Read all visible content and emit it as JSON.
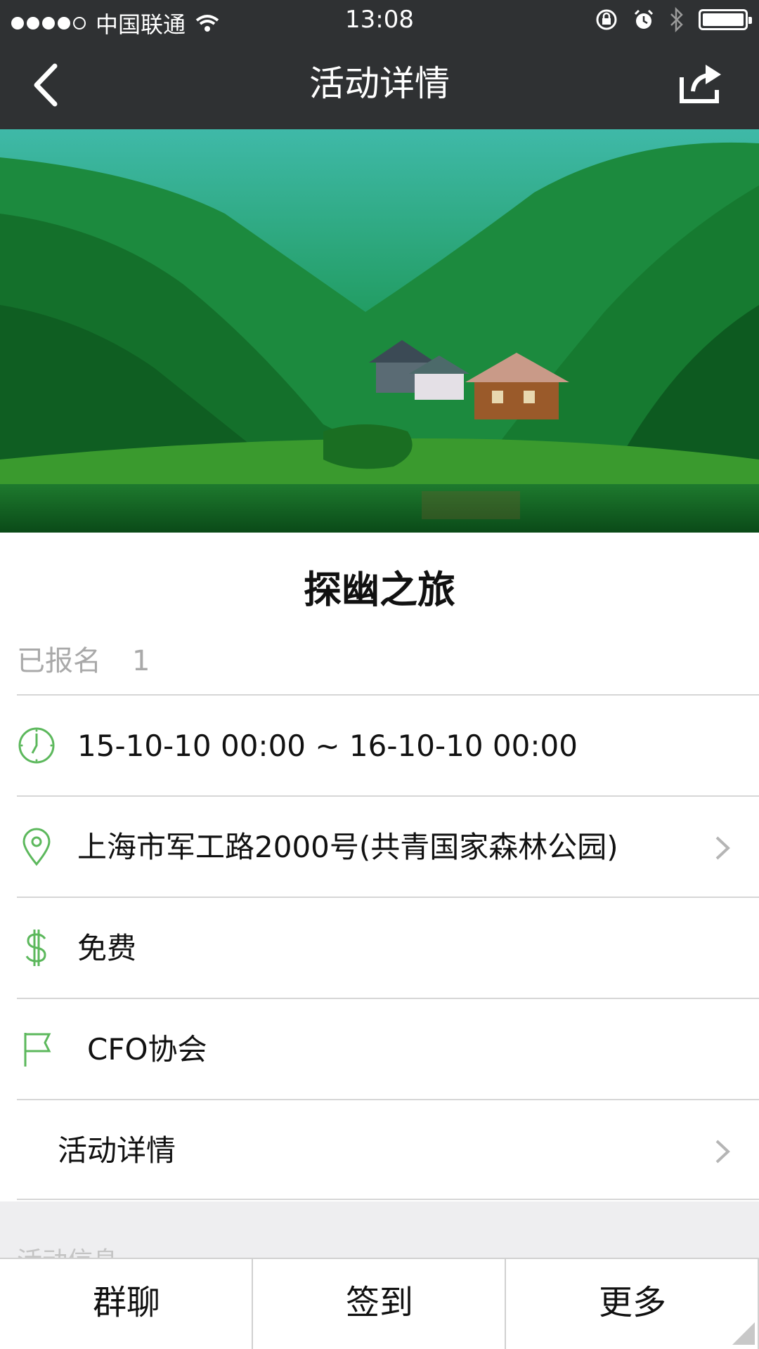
{
  "status_bar": {
    "carrier": "中国联通",
    "time": "13:08"
  },
  "nav": {
    "title": "活动详情",
    "back_icon": "chevron-left-icon",
    "share_icon": "share-icon"
  },
  "event": {
    "title": "探幽之旅",
    "registered_label": "已报名",
    "registered_count": "1",
    "time_range": "15-10-10 00:00 ~ 16-10-10 00:00",
    "location": "上海市军工路2000号(共青国家森林公园)",
    "fee": "免费",
    "organizer": "CFO协会",
    "details_label": "活动详情"
  },
  "section_peek": "活动信息",
  "toolbar": {
    "group_chat": "群聊",
    "check_in": "签到",
    "more": "更多"
  },
  "colors": {
    "nav_bg": "#2f3133",
    "icon_green": "#5cb85c",
    "divider": "#d6d6d6",
    "muted_text": "#a9a9a9"
  }
}
